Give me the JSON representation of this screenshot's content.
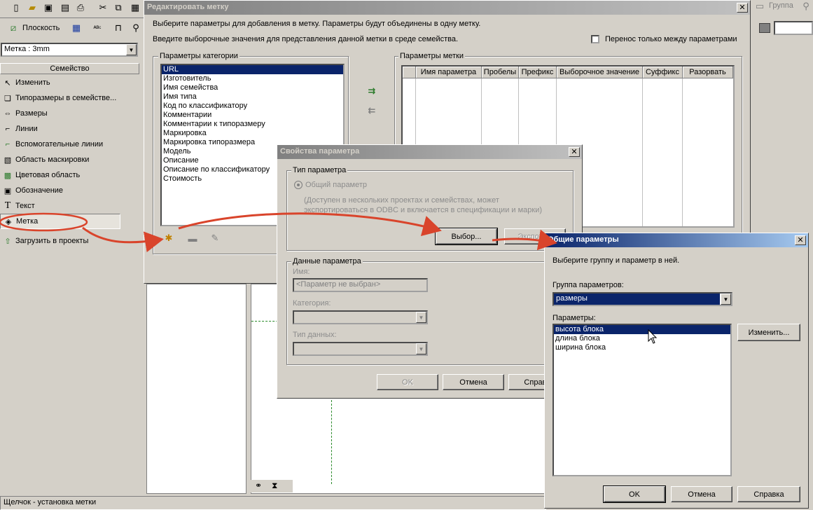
{
  "toolbar": {
    "plane_label": "Плоскость",
    "group_label": "Группа"
  },
  "type_selector": {
    "value": "Метка : 3mm"
  },
  "family_panel": {
    "header": "Семейство",
    "items": [
      {
        "label": "Изменить",
        "icon": "arrow-cursor-icon"
      },
      {
        "label": "Типоразмеры в семействе...",
        "icon": "layers-icon"
      },
      {
        "label": "Размеры",
        "icon": "dimension-icon"
      },
      {
        "label": "Линии",
        "icon": "lines-icon"
      },
      {
        "label": "Вспомогательные линии",
        "icon": "ref-lines-icon"
      },
      {
        "label": "Область маскировки",
        "icon": "masking-icon"
      },
      {
        "label": "Цветовая область",
        "icon": "filled-region-icon"
      },
      {
        "label": "Обозначение",
        "icon": "symbol-icon"
      },
      {
        "label": "Текст",
        "icon": "text-icon"
      },
      {
        "label": "Метка",
        "icon": "label-icon"
      },
      {
        "label": "Загрузить в проекты",
        "icon": "load-icon"
      }
    ]
  },
  "status_bar": {
    "text": "Щелчок - установка метки"
  },
  "edit_label_dialog": {
    "title": "Редактировать метку",
    "instruction1": "Выберите параметры для добавления в метку.  Параметры будут объединены в одну метку.",
    "instruction2": "Введите выборочные значения для представления данной метки в среде семейства.",
    "wrap_checkbox": "Перенос только между параметрами",
    "category_params_label": "Параметры категории",
    "category_params": [
      "URL",
      "Изготовитель",
      "Имя семейства",
      "Имя типа",
      "Код по классификатору",
      "Комментарии",
      "Комментарии к типоразмеру",
      "Маркировка",
      "Маркировка типоразмера",
      "Модель",
      "Описание",
      "Описание по классификатору",
      "Стоимость"
    ],
    "label_params_label": "Параметры метки",
    "grid_columns": [
      "Имя параметра",
      "Пробелы",
      "Префикс",
      "Выборочное значение",
      "Суффикс",
      "Разорвать"
    ]
  },
  "param_props_dialog": {
    "title": "Свойства параметра",
    "type_group": "Тип параметра",
    "shared_radio": "Общий параметр",
    "shared_desc": "(Доступен в нескольких проектах и семействах, может экспортироваться в ODBC и включается в спецификации и марки)",
    "select_button": "Выбор...",
    "export_button": "Экспорт...",
    "data_group": "Данные параметра",
    "name_label": "Имя:",
    "name_value": "<Параметр не выбран>",
    "category_label": "Категория:",
    "datatype_label": "Тип данных:",
    "ok_button": "OK",
    "cancel_button": "Отмена",
    "help_button": "Справка"
  },
  "shared_params_dialog": {
    "title": "Общие параметры",
    "instruction": "Выберите группу и параметр в ней.",
    "group_label": "Группа параметров:",
    "group_value": "размеры",
    "params_label": "Параметры:",
    "params": [
      "высота блока",
      "длина блока",
      "ширина блока"
    ],
    "edit_button": "Изменить...",
    "ok_button": "OK",
    "cancel_button": "Отмена",
    "help_button": "Справка"
  },
  "colors": {
    "annotation_arrow": "#d9442b",
    "title_active": "#0a246a",
    "selection": "#0a246a"
  }
}
